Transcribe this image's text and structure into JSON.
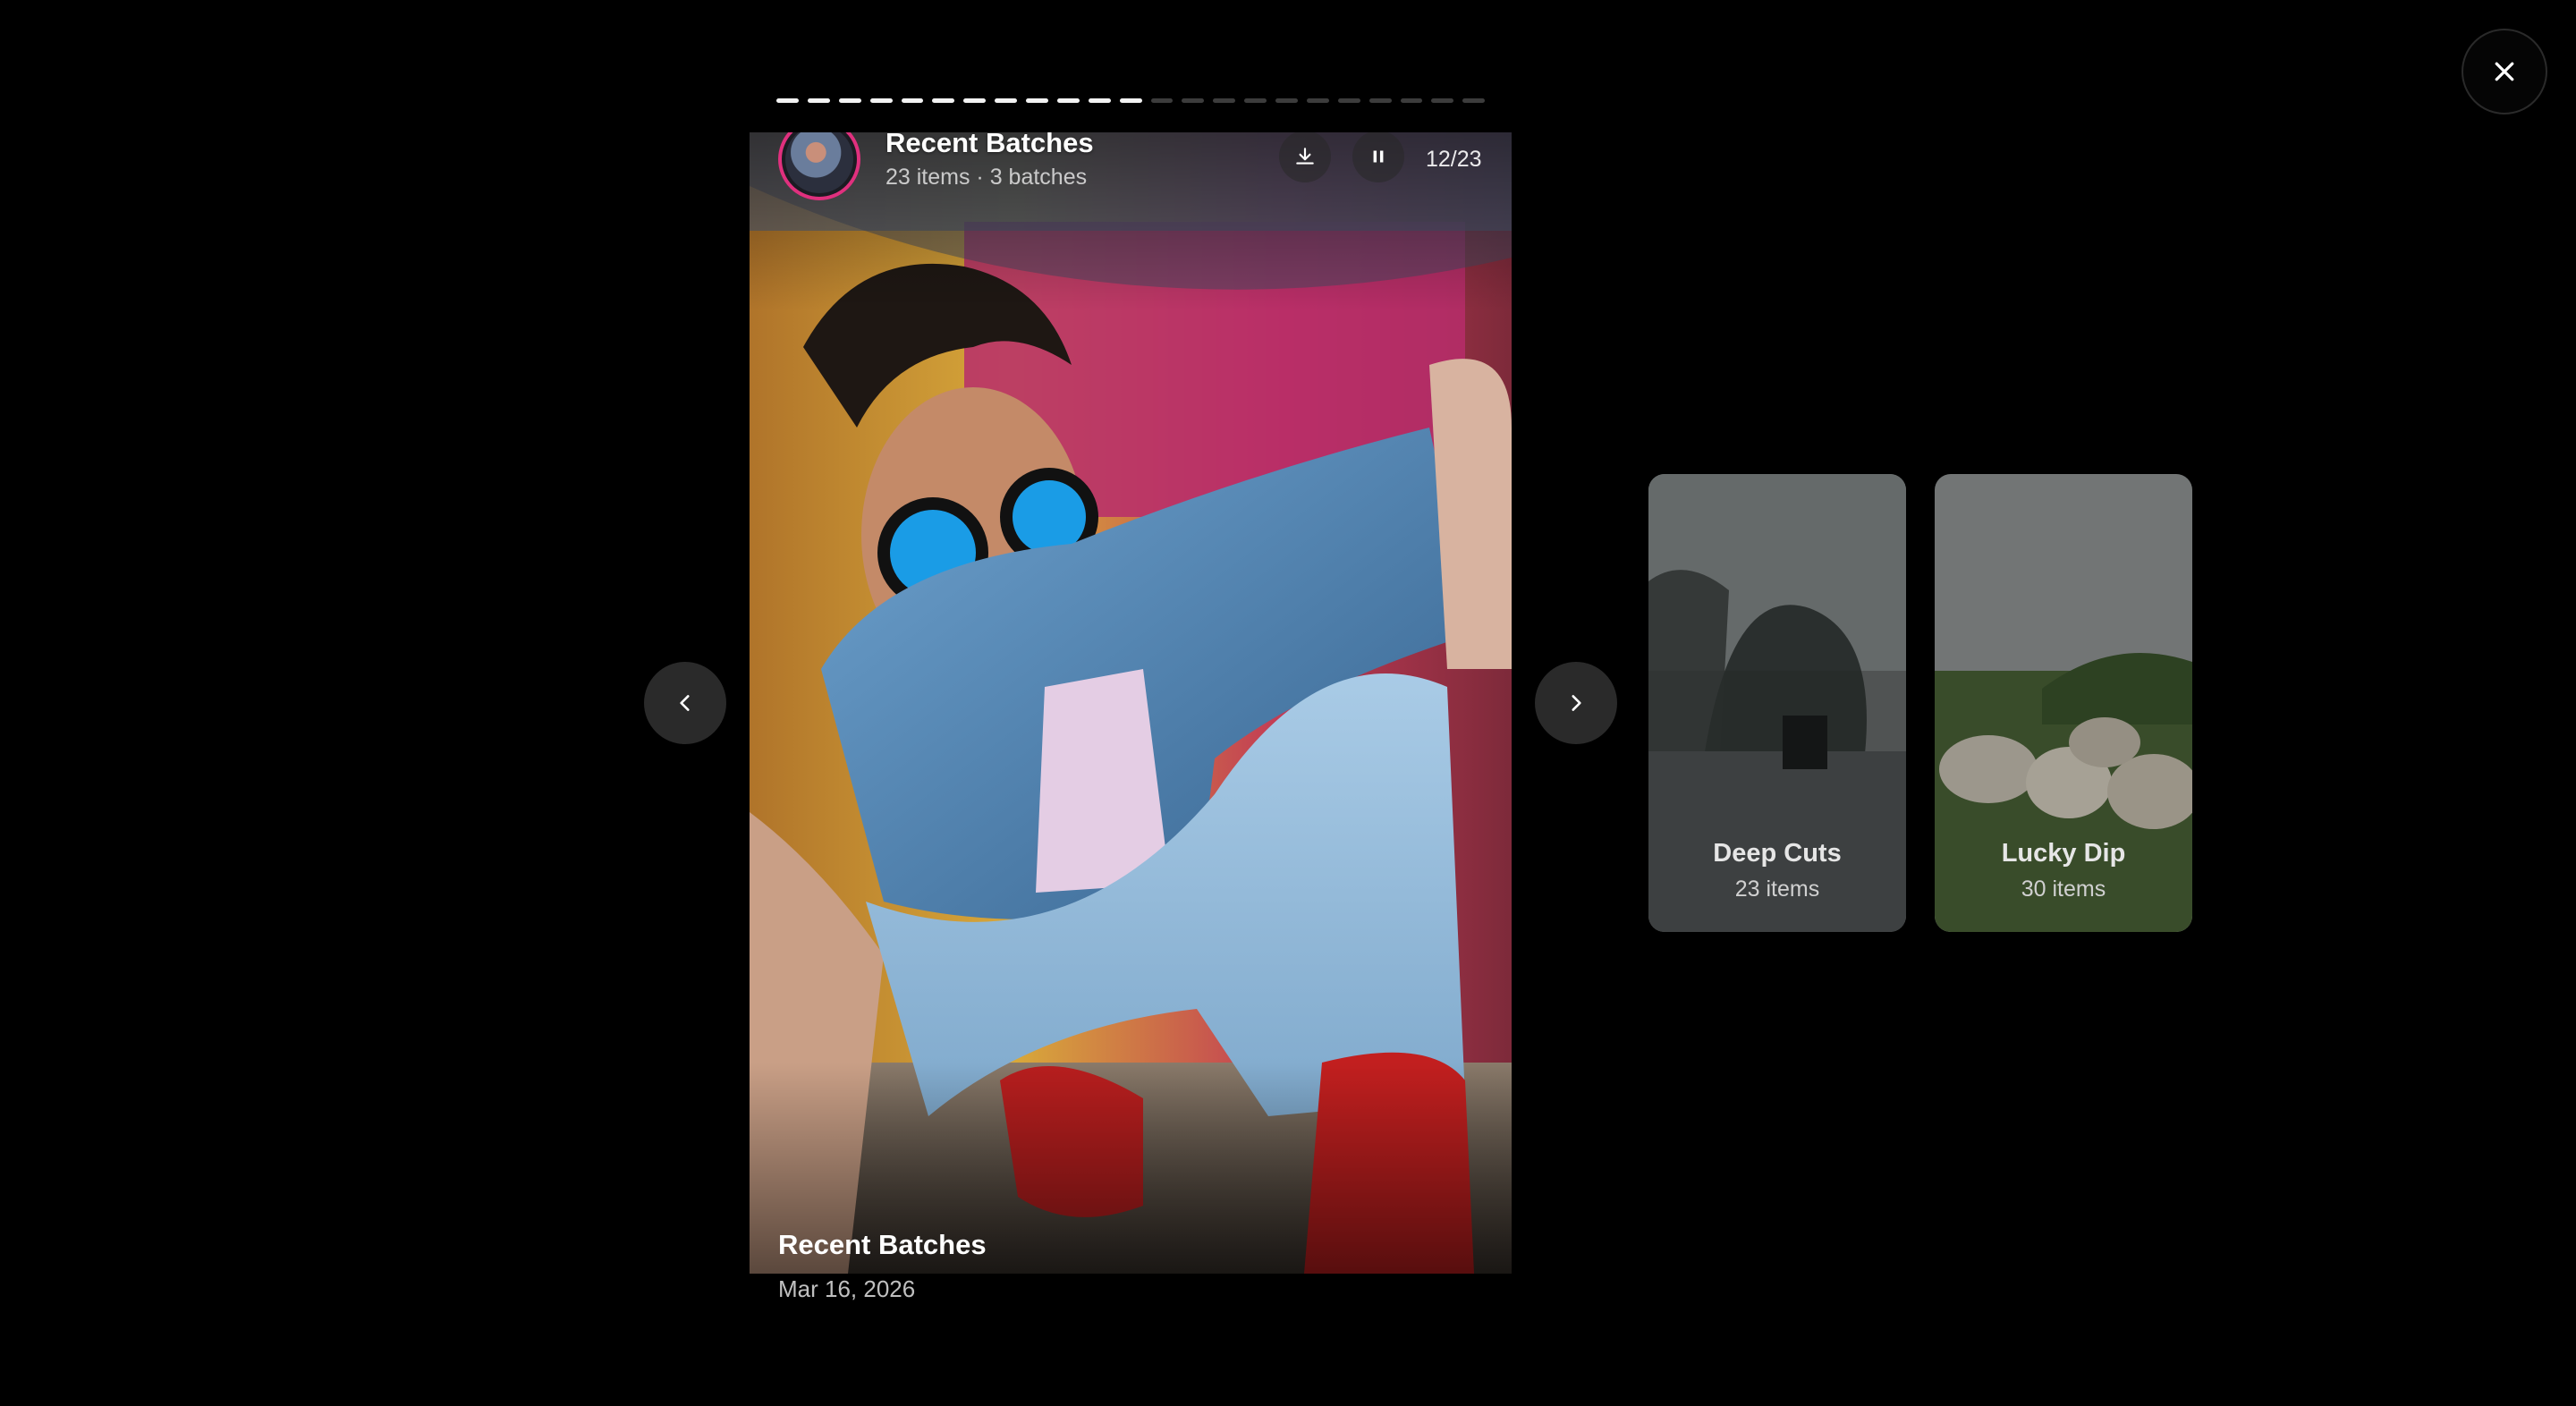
{
  "viewer": {
    "close_icon": "close-icon",
    "progress": {
      "total": 23,
      "current": 12
    }
  },
  "story": {
    "title": "Recent Batches",
    "subtitle": "23 items · 3 batches",
    "counter": "12/23",
    "date": "Mar 16, 2026",
    "footer_title": "Recent Batches",
    "icons": {
      "download": "download-icon",
      "pause": "pause-icon"
    },
    "avatar_ring_color": "#e0307e"
  },
  "nav": {
    "prev_icon": "chevron-left-icon",
    "next_icon": "chevron-right-icon"
  },
  "batches": [
    {
      "title": "Deep Cuts",
      "count": "23 items"
    },
    {
      "title": "Lucky Dip",
      "count": "30 items"
    }
  ]
}
